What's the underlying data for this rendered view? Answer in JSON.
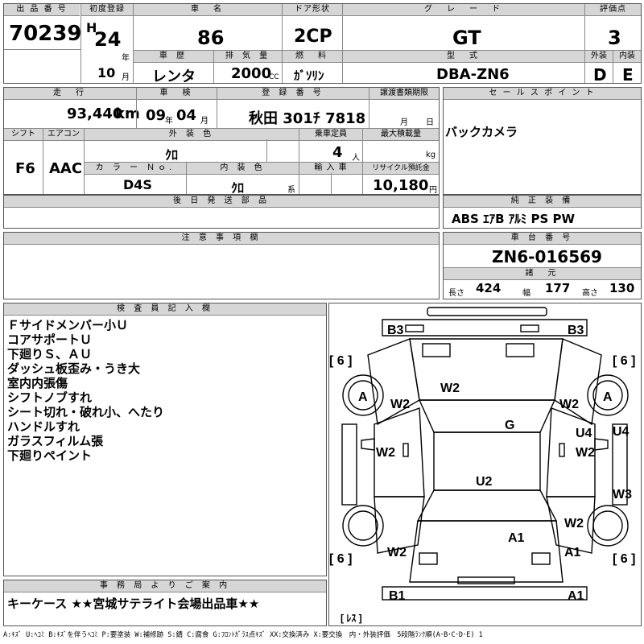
{
  "header": {
    "lot_label": "出 品 番 号",
    "lot_no": "70239",
    "first_reg_label": "初度登録",
    "era": "H",
    "year": "24",
    "year_unit": "年",
    "month": "10",
    "month_unit": "月",
    "name_label": "車　名",
    "name": "86",
    "door_label": "ドア形状",
    "door": "2CP",
    "grade_label": "グ　レ　ー　ド",
    "grade": "GT",
    "score_label": "評価点",
    "score": "3",
    "history_label": "車 歴",
    "history": "レンタ",
    "displacement_label": "排 気 量",
    "displacement": "2000",
    "displacement_unit": "CC",
    "fuel_label": "燃　料",
    "fuel": "ｶﾞｿﾘﾝ",
    "model_label": "型　式",
    "model": "DBA-ZN6",
    "exterior_label": "外装",
    "exterior": "D",
    "interior_label": "内装",
    "interior": "E"
  },
  "row2": {
    "mileage_label": "走　行",
    "mileage": "93,440",
    "mileage_unit": "km",
    "inspection_label": "車　検",
    "insp_year": "09",
    "insp_year_unit": "年",
    "insp_month": "04",
    "insp_month_unit": "月",
    "reg_label": "登 録 番 号",
    "reg_no": "秋田 301ﾁ 7818",
    "transfer_label": "譲渡書類期限",
    "transfer_month_unit": "月",
    "transfer_day_unit": "日",
    "sales_label": "セ ー ル ス ポ イ ン ト",
    "sales_point": "バックカメラ"
  },
  "row3": {
    "shift_label": "シフト",
    "shift": "F6",
    "ac_label": "エアコン",
    "ac": "AAC",
    "ext_color_label": "外 装 色",
    "ext_color": "ｸﾛ",
    "capacity_label": "乗車定員",
    "capacity": "4",
    "capacity_unit": "人",
    "load_label": "最大積載量",
    "load_unit": "kg",
    "color_no_label": "カ ラ ー Ｎｏ.",
    "color_no": "D4S",
    "int_color_label": "内 装 色",
    "int_color": "ｸﾛ",
    "int_color_unit": "系",
    "import_label": "輸 入 車",
    "recycle_label": "リサイクル預託金",
    "recycle": "10,180",
    "recycle_unit": "円"
  },
  "later_parts_label": "後 日 発 送 部 品",
  "equipment_label": "純 正 装 備",
  "equipment": "ABS ｴｱB ｱﾙﾐ PS PW",
  "caution_label": "注 意 事 項 欄",
  "chassis_label": "車 台 番 号",
  "chassis_no": "ZN6-016569",
  "dims_label": "諸　元",
  "dims": {
    "length_label": "長さ",
    "length": "424",
    "width_label": "幅",
    "width": "177",
    "height_label": "高さ",
    "height": "130"
  },
  "inspector_label": "検 査 員 記 入 欄",
  "inspector_notes": [
    "Ｆサイドメンバー小Ｕ",
    "コアサポートＵ",
    "下廻りＳ、ＡＵ",
    "ダッシュ板歪み・うき大",
    "室内内張傷",
    "シフトノブすれ",
    "シート切れ・破れ小、へたり",
    "ハンドルすれ",
    "ガラスフィルム張",
    "下廻りペイント"
  ],
  "office_label": "事 務 局 よ り ご 案 内",
  "office_note": "キーケース ★★宮城サテライト会場出品車★★",
  "legend": "A:ｷｽﾞ U:ﾍｺﾐ B:ｷｽﾞを伴うﾍｺﾐ P:要塗装 W:補修跡 S:錆 C:腐食 G:ﾌﾛﾝﾄｶﾞﾗｽ点ｷｽﾞ XX:交換済み X:要交換　内・外装評価　5段階ﾗﾝｸ順(A･B･C･D･E) 1",
  "diagram": {
    "labels": [
      "B3",
      "B3",
      "[ 6 ]",
      "[ 6 ]",
      "A",
      "A",
      "W2",
      "W2",
      "W2",
      "G",
      "U4",
      "U4",
      "W2",
      "W2",
      "U2",
      "W3",
      "W2",
      "A1",
      "W2",
      "A1",
      "[ 6 ]",
      "[ 6 ]",
      "B1",
      "A1",
      "[ ﾚｽ ]"
    ]
  }
}
